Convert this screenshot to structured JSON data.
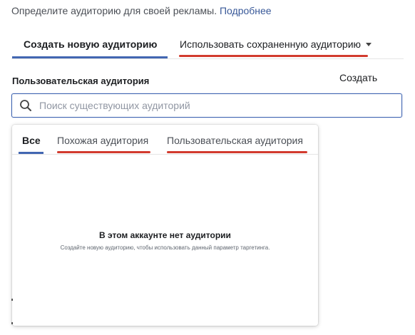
{
  "intro": {
    "text": "Определите аудиторию для своей рекламы.",
    "link_text": "Подробнее"
  },
  "tabs": {
    "create_new": "Создать новую аудиторию",
    "use_saved": "Использовать сохраненную аудиторию"
  },
  "section": {
    "label": "Пользовательская аудитория",
    "create_button": "Создать"
  },
  "search": {
    "placeholder": "Поиск существующих аудиторий",
    "value": ""
  },
  "dropdown": {
    "tabs": [
      {
        "label": "Все",
        "active": true
      },
      {
        "label": "Похожая аудитория",
        "active": false
      },
      {
        "label": "Пользовательская аудитория",
        "active": false
      }
    ],
    "empty_title": "В этом аккаунте нет аудитории",
    "empty_subtitle": "Создайте новую аудиторию, чтобы использовать данный параметр таргетинга."
  },
  "colors": {
    "accent": "#4267b2",
    "link": "#385898",
    "annotation_underline": "#d23b2e"
  }
}
